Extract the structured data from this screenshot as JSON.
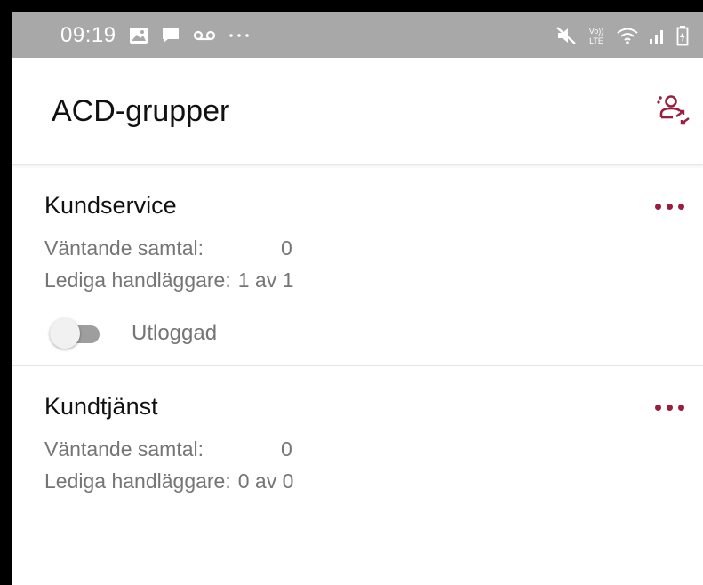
{
  "status_bar": {
    "time": "09:19",
    "left_icons": [
      "image-icon",
      "message-icon",
      "voicemail-icon",
      "more-dots-icon"
    ],
    "right_icons": [
      "mute-icon",
      "volte-icon",
      "wifi-icon",
      "signal-icon",
      "battery-icon"
    ],
    "volte_top": "Vo))",
    "volte_bottom": "LTE"
  },
  "header": {
    "title": "ACD-grupper",
    "action_icon": "agent-switch-icon"
  },
  "colors": {
    "accent": "#9b1d40",
    "status_bar": "#a8a8a8",
    "secondary_text": "#757575"
  },
  "groups": [
    {
      "name": "Kundservice",
      "waiting_label": "Väntande samtal:",
      "waiting_value": "0",
      "available_label": "Lediga handläggare:",
      "available_value": "1 av 1",
      "toggle_state": "off",
      "toggle_label": "Utloggad"
    },
    {
      "name": "Kundtjänst",
      "waiting_label": "Väntande samtal:",
      "waiting_value": "0",
      "available_label": "Lediga handläggare:",
      "available_value": "0 av 0"
    }
  ]
}
